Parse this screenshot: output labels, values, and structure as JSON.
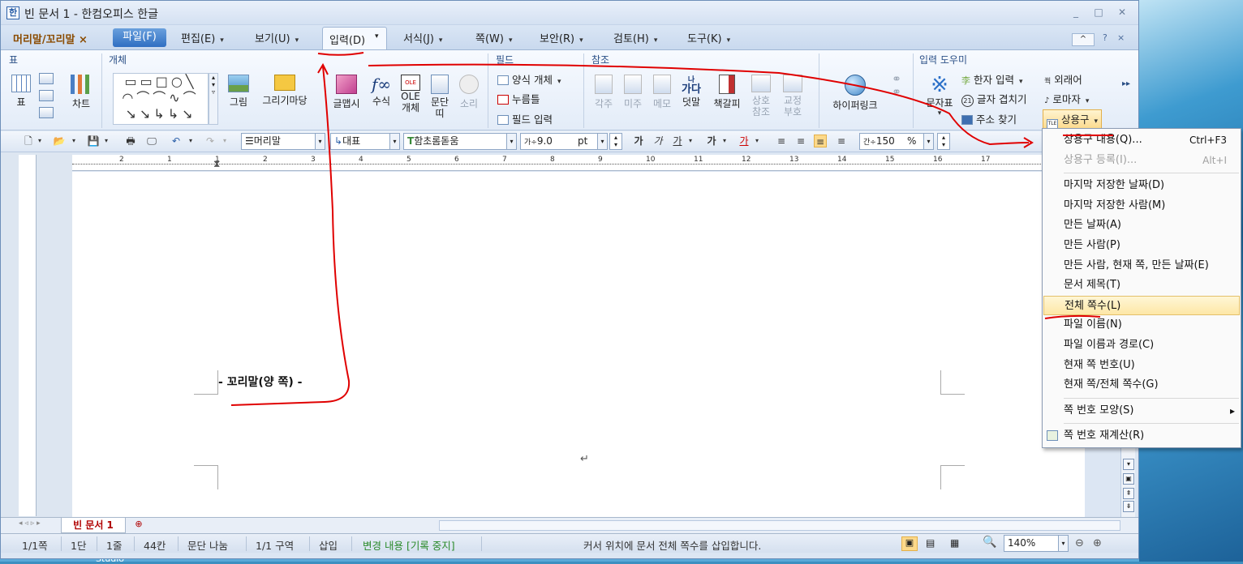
{
  "window": {
    "title": "빈 문서 1 - 한컴오피스 한글",
    "controls": [
      "_",
      "□",
      "✕"
    ]
  },
  "menubar": {
    "doc_tab": "머리말/꼬리말 ×",
    "items": [
      {
        "label": "파일(F)"
      },
      {
        "label": "편집(E)"
      },
      {
        "label": "보기(U)"
      },
      {
        "label": "입력(D)"
      },
      {
        "label": "서식(J)"
      },
      {
        "label": "쪽(W)"
      },
      {
        "label": "보안(R)"
      },
      {
        "label": "검토(H)"
      },
      {
        "label": "도구(K)"
      }
    ],
    "right": [
      "^",
      "?",
      "×"
    ]
  },
  "ribbon": {
    "groups": {
      "table": "표",
      "object": "개체",
      "field": "필드",
      "ref": "참조",
      "input_help": "입력 도우미"
    },
    "table_btn": "표",
    "chart_btn": "차트",
    "picture_btn": "그림",
    "drawing_btn": "그리기마당",
    "wordart_btn": "글맵시",
    "formula_btn": "수식",
    "ole_btn": "OLE\n개체",
    "para_btn": "문단\n띠",
    "sound_btn": "소리",
    "form_obj": "양식 개체",
    "push_btn": "누름틀",
    "field_input": "필드 입력",
    "footnote_btn": "각주",
    "endnote_btn": "미주",
    "memo_btn": "메모",
    "ruby_btn": "덧말",
    "bookmark_btn": "책갈피",
    "crossref_btn": "상호\n참조",
    "proof_btn": "교정\n부호",
    "hyperlink_btn": "하이퍼링크",
    "charmap_btn": "문자표",
    "hanja_input": "한자 입력",
    "overlap_chars": "글자 겹치기",
    "address_search": "주소 찾기",
    "foreign_word": "외래어",
    "romaja": "로마자",
    "common_phrase": "상용구"
  },
  "toolbar": {
    "style": "머리말",
    "font_lang": "대표",
    "font": "함초롬돋움",
    "size": "9.0",
    "unit": "pt",
    "bold": "가",
    "italic": "가",
    "underline": "가",
    "strike": "가",
    "color": "가",
    "zoom": "150",
    "zoom_unit": "%"
  },
  "ruler": {
    "numbers": [
      "2",
      "1",
      "1",
      "2",
      "3",
      "4",
      "5",
      "6",
      "7",
      "8",
      "9",
      "10",
      "11",
      "12",
      "13",
      "14",
      "15",
      "16",
      "17"
    ]
  },
  "document": {
    "footer_text": "- 꼬리말(양 쪽) -",
    "enter_mark": "↵"
  },
  "tabs": {
    "doc": "빈 문서 1"
  },
  "status": {
    "page": "1/1쪽",
    "col": "1단",
    "line": "1줄",
    "char": "44칸",
    "para": "문단 나눔",
    "section": "1/1 구역",
    "mode": "삽입",
    "track": "변경 내용 [기록 중지]",
    "message": "커서 위치에 문서 전체 쪽수를 삽입합니다.",
    "zoom": "140%"
  },
  "dropdown": {
    "items": [
      {
        "label": "상용구 내용(Q)...",
        "shortcut": "Ctrl+F3",
        "disabled": false
      },
      {
        "label": "상용구 등록(I)...",
        "shortcut": "Alt+I",
        "disabled": true
      },
      {
        "label": "마지막 저장한 날짜(D)"
      },
      {
        "label": "마지막 저장한 사람(M)"
      },
      {
        "label": "만든 날짜(A)"
      },
      {
        "label": "만든 사람(P)"
      },
      {
        "label": "만든 사람, 현재 쪽, 만든 날짜(E)"
      },
      {
        "label": "문서 제목(T)"
      },
      {
        "label": "전체 쪽수(L)",
        "highlighted": true
      },
      {
        "label": "파일 이름(N)"
      },
      {
        "label": "파일 이름과 경로(C)"
      },
      {
        "label": "현재 쪽 번호(U)"
      },
      {
        "label": "현재 쪽/전체 쪽수(G)"
      },
      {
        "label": "쪽 번호 모양(S)",
        "submenu": "▸"
      },
      {
        "label": "쪽 번호 재계산(R)"
      }
    ]
  },
  "desktop_label": "Studio"
}
